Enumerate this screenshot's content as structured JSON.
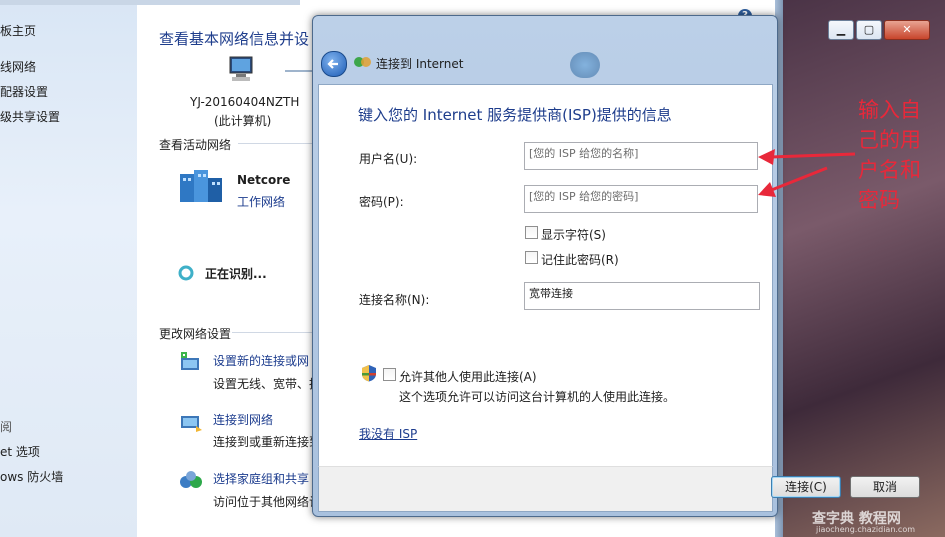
{
  "background_window": {
    "sidebar": {
      "home": "板主页",
      "items": [
        "线网络",
        "配器设置",
        "级共享设置"
      ],
      "see_also_title": "阅",
      "see_also": [
        "et 选项",
        "ows 防火墙"
      ]
    },
    "main": {
      "title": "查看基本网络信息并设",
      "computer_name": "YJ-20160404NZTH",
      "computer_sub": "(此计算机)",
      "active_header": "查看活动网络",
      "network_name": "Netcore",
      "network_type": "工作网络",
      "identifying": "正在识别...",
      "change_header": "更改网络设置",
      "tasks": [
        {
          "link": "设置新的连接或网",
          "desc": "设置无线、宽带、拨"
        },
        {
          "link": "连接到网络",
          "desc": "连接到或重新连接到"
        },
        {
          "link": "选择家庭组和共享",
          "desc": "访问位于其他网络计"
        }
      ]
    }
  },
  "dialog": {
    "title": "连接到 Internet",
    "heading": "键入您的 Internet 服务提供商(ISP)提供的信息",
    "username_label": "用户名(U):",
    "username_placeholder": "[您的 ISP 给您的名称]",
    "password_label": "密码(P):",
    "password_placeholder": "[您的 ISP 给您的密码]",
    "show_chars": "显示字符(S)",
    "remember_pw": "记住此密码(R)",
    "conn_name_label": "连接名称(N):",
    "conn_name_value": "宽带连接",
    "allow_others": "允许其他人使用此连接(A)",
    "allow_desc": "这个选项允许可以访问这台计算机的人使用此连接。",
    "no_isp": "我没有 ISP",
    "connect_btn": "连接(C)",
    "cancel_btn": "取消"
  },
  "annotation": {
    "lines": [
      "输入自",
      "己的用",
      "户名和",
      "密码"
    ],
    "color": "#e8283a"
  },
  "watermark": {
    "line1": "查字典 教程网",
    "line2": "jiaocheng.chazidian.com"
  }
}
